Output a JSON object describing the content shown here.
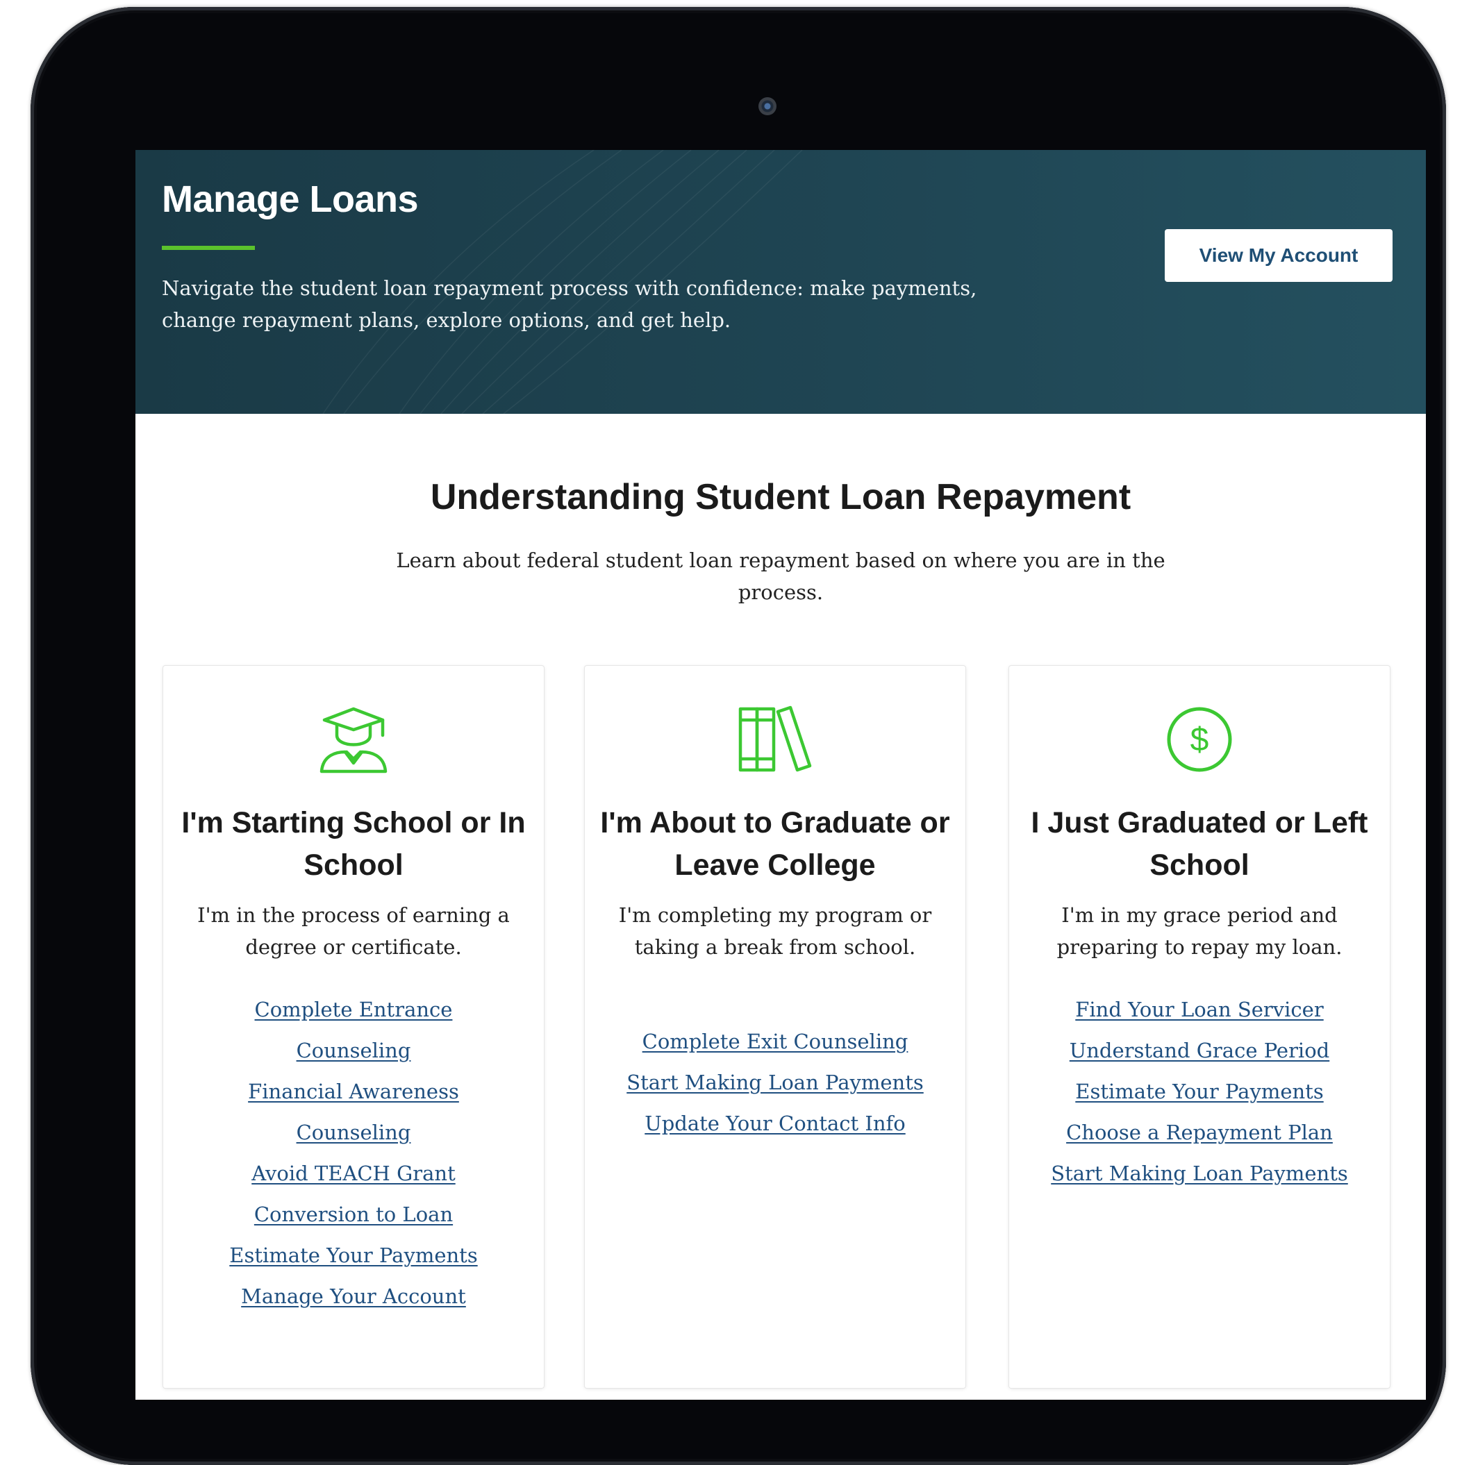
{
  "hero": {
    "title": "Manage Loans",
    "description": "Navigate the student loan repayment process with confidence: make payments, change repayment plans, explore options, and get help.",
    "button_label": "View My Account",
    "background_color": "#1f4553",
    "accent_color": "#5bc22c"
  },
  "section": {
    "title": "Understanding Student Loan Repayment",
    "subtitle": "Learn about federal student loan repayment based on where you are in the process."
  },
  "cards": [
    {
      "icon": "graduate-student-icon",
      "title": "I'm Starting School or In School",
      "description": "I'm in the process of earning a degree or certificate.",
      "links": [
        "Complete Entrance",
        "Counseling",
        "Financial Awareness",
        "Counseling",
        "Avoid TEACH Grant",
        "Conversion to Loan",
        "Estimate Your Payments",
        "Manage Your Account"
      ]
    },
    {
      "icon": "books-icon",
      "title": "I'm About to Graduate or Leave College",
      "description": "I'm completing my program or taking a break from school.",
      "links": [
        "Complete Exit Counseling",
        "Start Making Loan Payments",
        "Update Your Contact Info"
      ]
    },
    {
      "icon": "dollar-circle-icon",
      "title": "I Just Graduated or Left School",
      "description": "I'm in my grace period and preparing to repay my loan.",
      "links": [
        "Find Your Loan Servicer",
        "Understand Grace Period",
        "Estimate Your Payments",
        "Choose a Repayment Plan",
        "Start Making Loan Payments"
      ]
    }
  ],
  "colors": {
    "icon_green": "#3cc832",
    "link_blue": "#1f4f80"
  }
}
